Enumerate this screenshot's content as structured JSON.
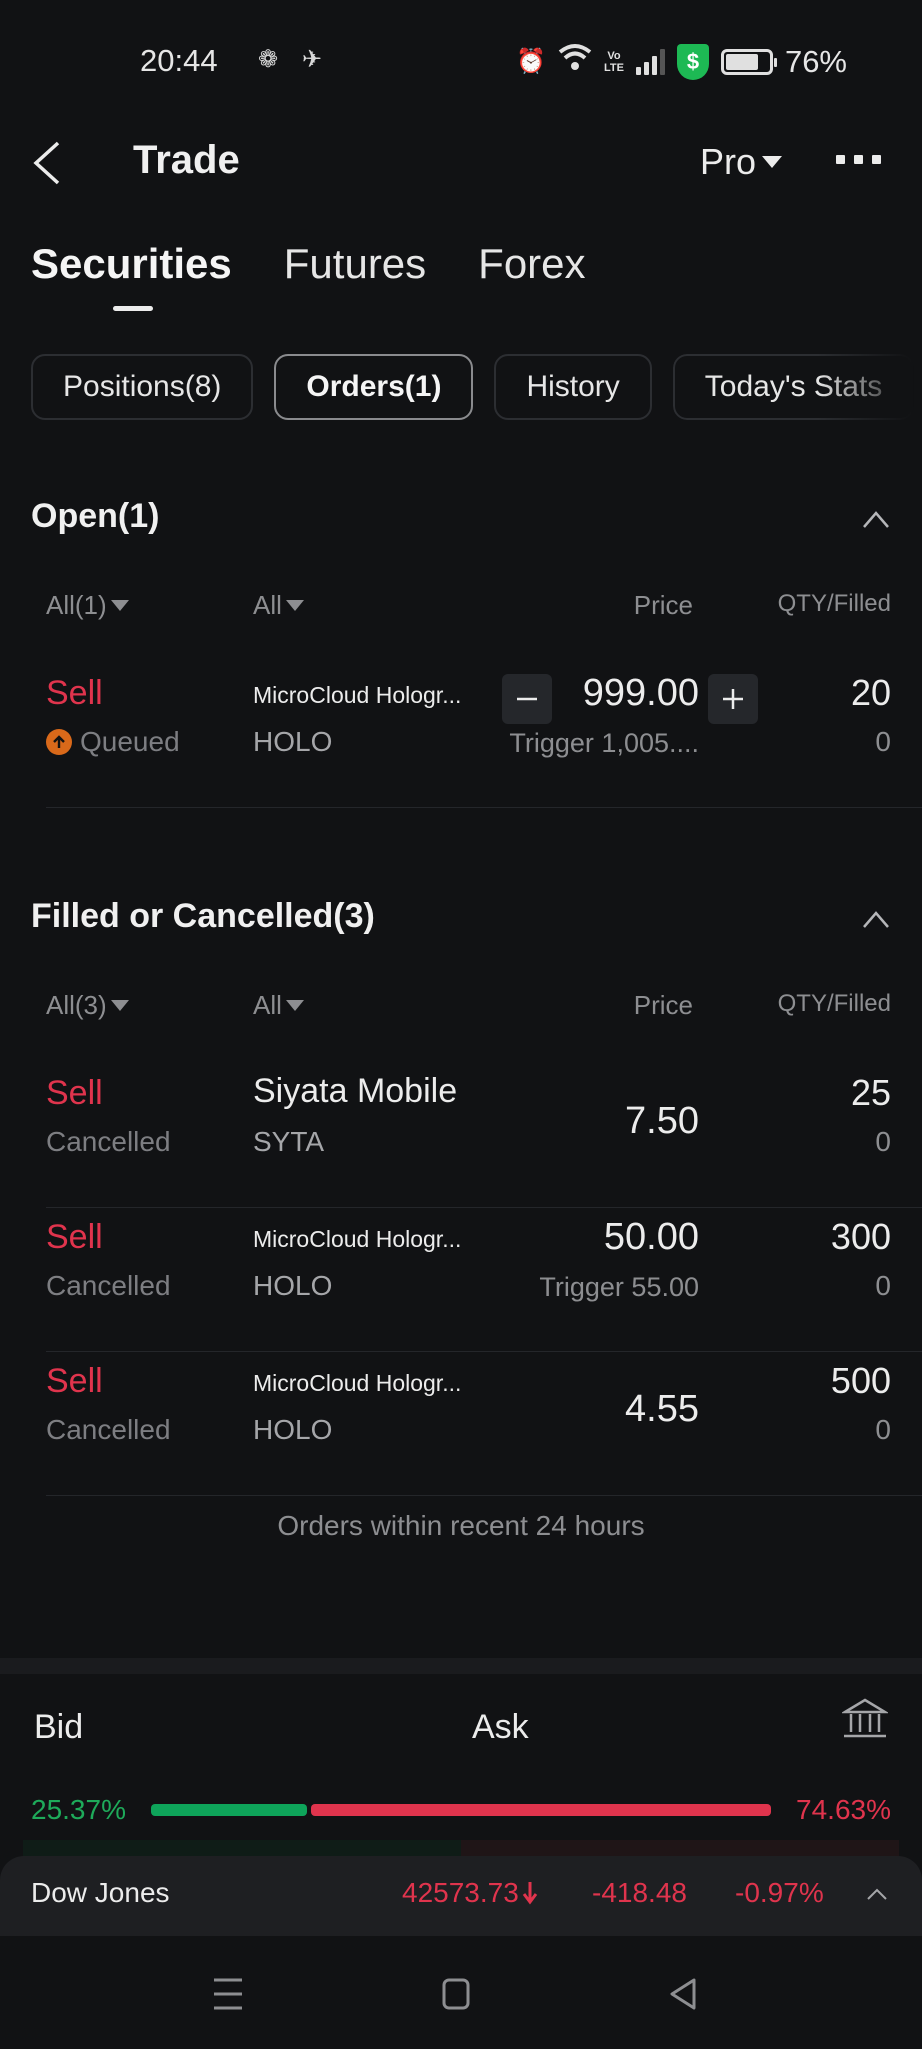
{
  "status_bar": {
    "time": "20:44",
    "battery_percent": "76%",
    "battery_level": 0.76,
    "network": "VoLTE",
    "icons": [
      "app-notification-icon",
      "app-notification-icon-2",
      "alarm-icon",
      "wifi-icon",
      "volte-icon",
      "signal-icon",
      "security-shield-icon",
      "battery-icon"
    ],
    "volte_top": "Vo",
    "volte_bottom": "LTE",
    "shield_glyph": "$"
  },
  "header": {
    "title": "Trade",
    "mode_label": "Pro"
  },
  "main_tabs": [
    {
      "label": "Securities",
      "active": true
    },
    {
      "label": "Futures",
      "active": false
    },
    {
      "label": "Forex",
      "active": false
    }
  ],
  "sub_tabs": [
    {
      "label": "Positions(8)",
      "active": false
    },
    {
      "label": "Orders(1)",
      "active": true
    },
    {
      "label": "History",
      "active": false
    },
    {
      "label": "Today's Stats",
      "active": false
    }
  ],
  "open_section": {
    "title": "Open(1)",
    "columns": {
      "side_filter": "All(1)",
      "type_filter": "All",
      "price": "Price",
      "qty": "QTY/Filled"
    },
    "orders": [
      {
        "side": "Sell",
        "status": "Queued",
        "name": "MicroCloud Hologr...",
        "ticker": "HOLO",
        "price": "999.00",
        "trigger": "Trigger 1,005....",
        "qty": "20",
        "filled": "0"
      }
    ]
  },
  "closed_section": {
    "title": "Filled or Cancelled(3)",
    "columns": {
      "side_filter": "All(3)",
      "type_filter": "All",
      "price": "Price",
      "qty": "QTY/Filled"
    },
    "orders": [
      {
        "side": "Sell",
        "status": "Cancelled",
        "name": "Siyata Mobile",
        "ticker": "SYTA",
        "price": "7.50",
        "trigger": "",
        "qty": "25",
        "filled": "0"
      },
      {
        "side": "Sell",
        "status": "Cancelled",
        "name": "MicroCloud Hologr...",
        "ticker": "HOLO",
        "price": "50.00",
        "trigger": "Trigger 55.00",
        "qty": "300",
        "filled": "0"
      },
      {
        "side": "Sell",
        "status": "Cancelled",
        "name": "MicroCloud Hologr...",
        "ticker": "HOLO",
        "price": "4.55",
        "trigger": "",
        "qty": "500",
        "filled": "0"
      }
    ],
    "footer_note": "Orders within recent 24 hours"
  },
  "bid_ask": {
    "bid_label": "Bid",
    "ask_label": "Ask",
    "bid_percent": "25.37%",
    "ask_percent": "74.63%",
    "bid_fraction": 0.2537,
    "ask_fraction": 0.7463
  },
  "index_ticker": {
    "name": "Dow Jones",
    "value": "42573.73",
    "change": "-418.48",
    "change_percent": "-0.97%",
    "direction": "down"
  },
  "colors": {
    "background": "#111214",
    "sell_red": "#e0344d",
    "bid_green": "#0ea45a",
    "queued_orange": "#d9691a",
    "shield_green": "#1db954"
  }
}
